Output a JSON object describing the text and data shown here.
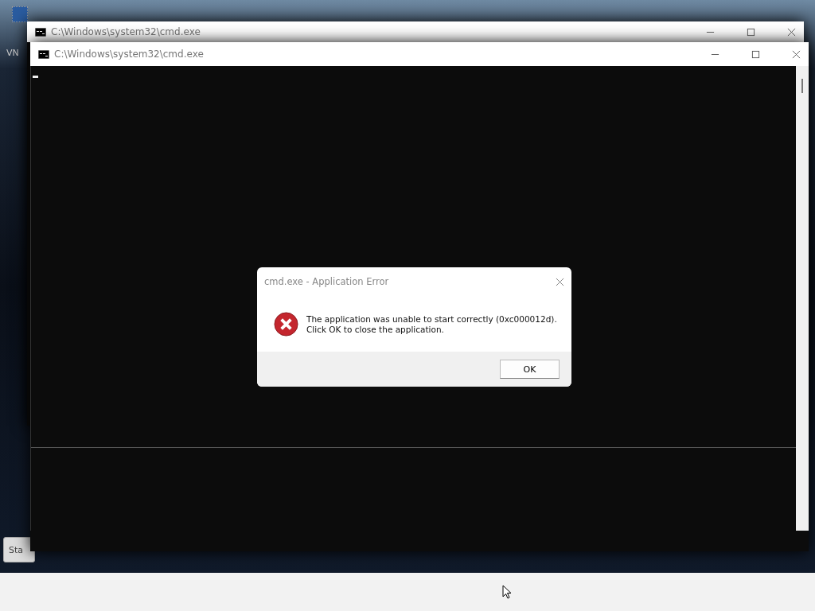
{
  "desktop": {
    "icon_label": "VN",
    "start_button": "Sta"
  },
  "windows": [
    {
      "title": "C:\\Windows\\system32\\cmd.exe"
    },
    {
      "title": "C:\\Windows\\system32\\cmd.exe"
    }
  ],
  "dialog": {
    "title": "cmd.exe - Application Error",
    "message_lines": [
      "The application was unable to start correctly (0xc000012d).",
      "Click OK to close the application."
    ],
    "buttons": [
      "OK"
    ]
  }
}
